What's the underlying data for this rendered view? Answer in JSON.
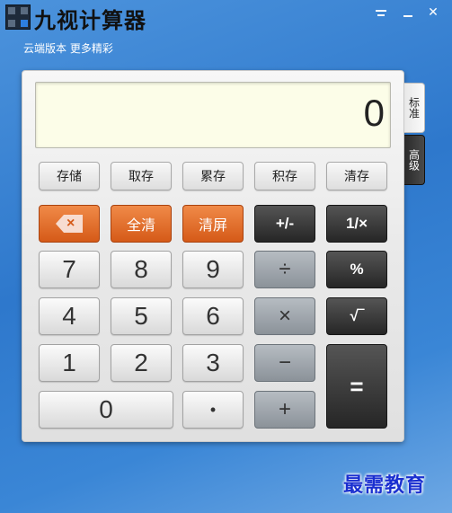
{
  "app": {
    "title": "九视计算器",
    "subtitle": "云端版本 更多精彩"
  },
  "display": {
    "value": "0"
  },
  "memory_buttons": [
    "存储",
    "取存",
    "累存",
    "积存",
    "清存"
  ],
  "row2": {
    "backspace": "×",
    "clear_all": "全清",
    "clear_screen": "清屏",
    "negate": "+/-",
    "reciprocal": "1/×"
  },
  "keys": {
    "seven": "7",
    "eight": "8",
    "nine": "9",
    "divide": "÷",
    "percent": "%",
    "four": "4",
    "five": "5",
    "six": "6",
    "multiply": "×",
    "sqrt": "√‾",
    "one": "1",
    "two": "2",
    "three": "3",
    "minus": "−",
    "zero": "0",
    "dot": "•",
    "plus": "+",
    "equals": "="
  },
  "tabs": {
    "standard": "标准",
    "advanced": "高级"
  },
  "watermark": "最需教育",
  "colors": {
    "orange_accent": "#e06a28",
    "dark_key": "#333333",
    "display_bg": "#fcfde8"
  }
}
